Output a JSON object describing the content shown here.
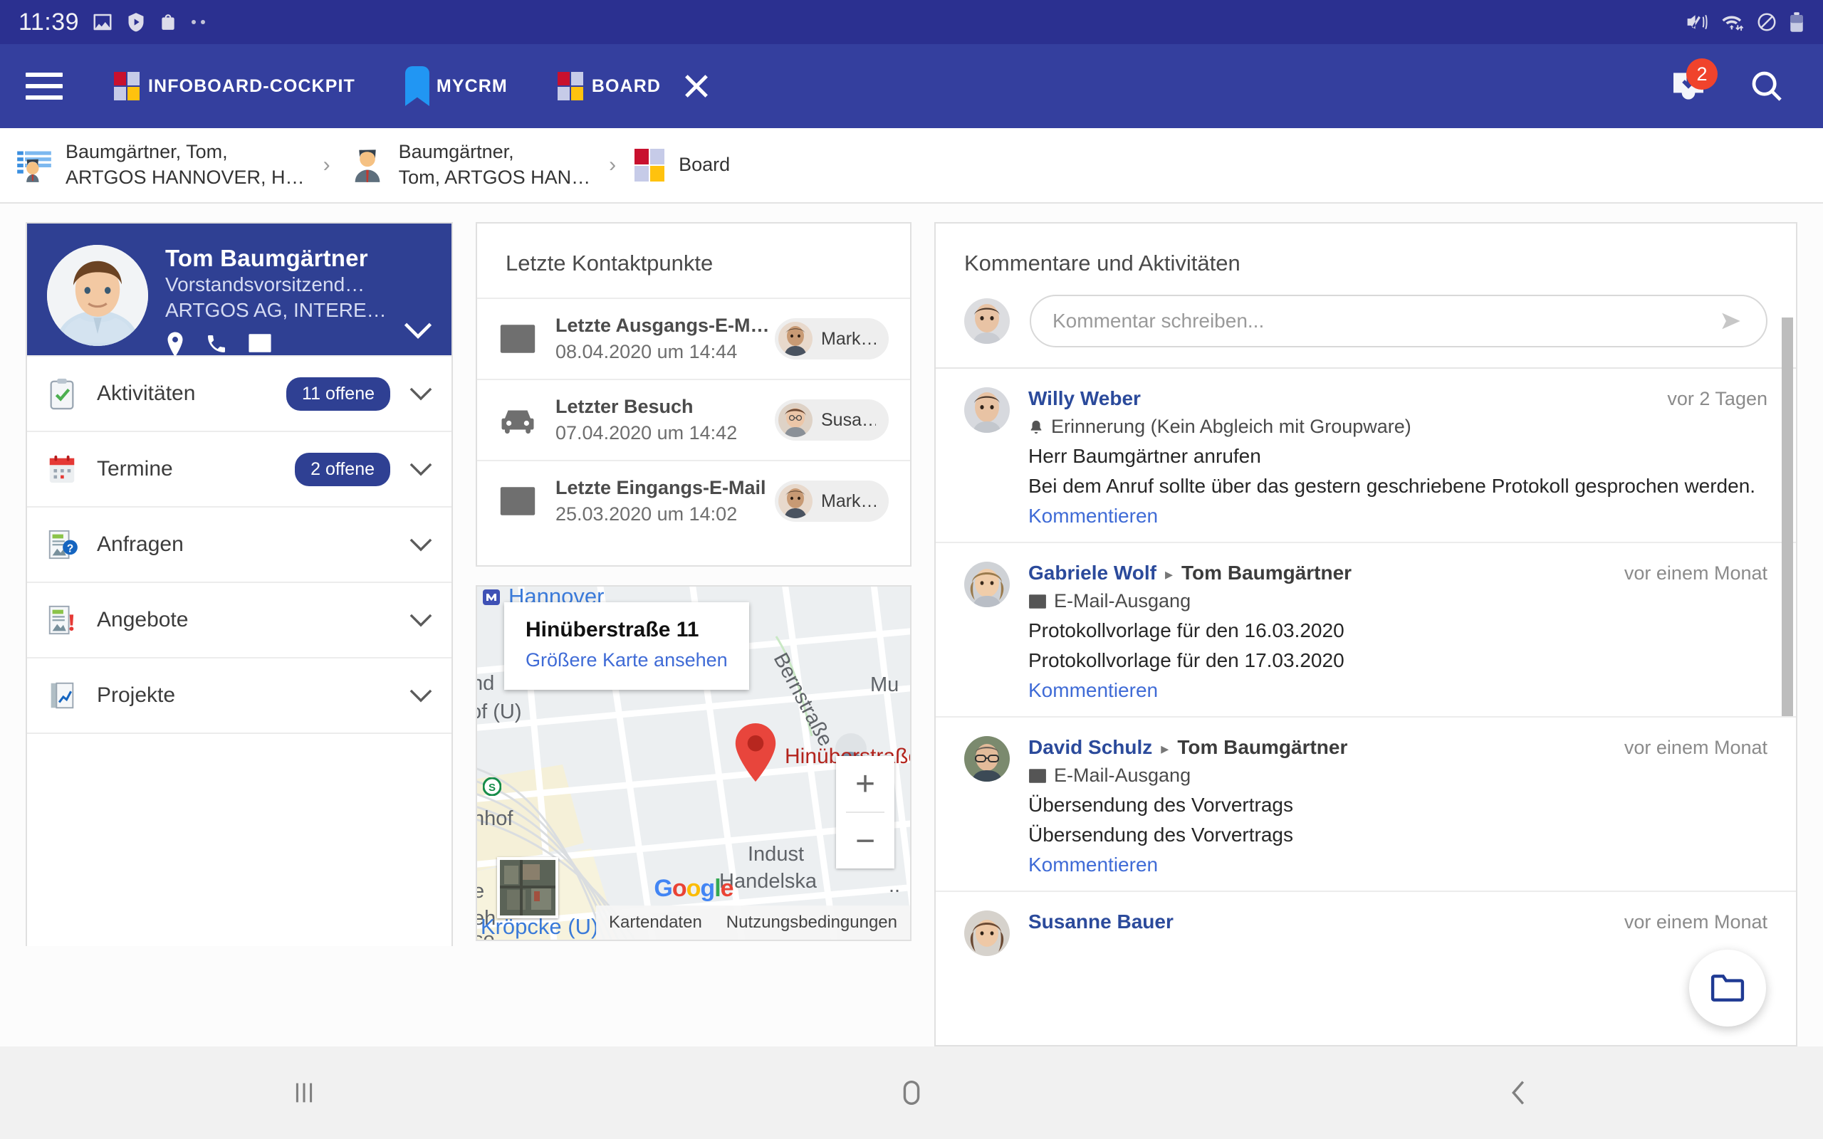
{
  "statusbar": {
    "clock": "11:39",
    "left_icons": [
      "image-icon",
      "shield-play-icon",
      "shopping-bag-icon",
      "more-dots-icon"
    ],
    "right_icons": [
      "mute-vibrate-icon",
      "wifi-transfer-icon",
      "do-not-disturb-icon",
      "battery-icon"
    ]
  },
  "appbar": {
    "menu": "menu-icon",
    "tabs": [
      {
        "label": "INFOBOARD-COCKPIT",
        "icon": "infoboard-logo-icon"
      },
      {
        "label": "MYCRM",
        "icon": "bookmark-icon"
      },
      {
        "label": "BOARD",
        "icon": "infoboard-logo-icon",
        "closable": true
      }
    ],
    "inbox_icon": "inbox-download-icon",
    "inbox_badge": "2",
    "search_icon": "search-icon",
    "accent": "#343f9e",
    "badge_color": "#f0432c"
  },
  "breadcrumb": {
    "items": [
      {
        "label": "Baumgärtner, Tom,\nARTGOS HANNOVER, H…",
        "icon": "contact-list-icon"
      },
      {
        "label": "Baumgärtner,\nTom, ARTGOS HAN…",
        "icon": "person-icon"
      },
      {
        "label": "Board",
        "icon": "infoboard-logo-icon"
      }
    ],
    "separator": "›"
  },
  "profile": {
    "name": "Tom Baumgärtner",
    "role": "Vorstandsvorsitzend…",
    "company": "ARTGOS AG, INTERE…",
    "actions": [
      "location-pin-icon",
      "phone-icon",
      "mail-icon"
    ],
    "expand_icon": "chevron-down-icon",
    "header_color": "#2f4093",
    "rows": [
      {
        "label": "Aktivitäten",
        "badge": "11 offene",
        "icon": "clipboard-check-icon"
      },
      {
        "label": "Termine",
        "badge": "2 offene",
        "icon": "calendar-icon"
      },
      {
        "label": "Anfragen",
        "badge": "",
        "icon": "request-document-icon"
      },
      {
        "label": "Angebote",
        "badge": "",
        "icon": "offer-document-icon"
      },
      {
        "label": "Projekte",
        "badge": "",
        "icon": "project-chart-icon"
      }
    ]
  },
  "contact_points": {
    "title": "Letzte Kontaktpunkte",
    "items": [
      {
        "title": "Letzte Ausgangs-E-M…",
        "date": "08.04.2020 um 14:44",
        "person": "Mark…",
        "icon": "mail-icon"
      },
      {
        "title": "Letzter Besuch",
        "date": "07.04.2020 um 14:42",
        "person": "Susa…",
        "icon": "car-icon"
      },
      {
        "title": "Letzte Eingangs-E-Mail",
        "date": "25.03.2020 um 14:02",
        "person": "Mark…",
        "icon": "mail-icon"
      }
    ]
  },
  "map": {
    "info_title": "Hinüberstraße 11",
    "info_link": "Größere Karte ansehen",
    "pin_label": "Hinüberstraße 11",
    "city_label": "Hannover",
    "street_labels": [
      "Bernstraße",
      "Mu",
      "Indust",
      "Handelska",
      "nhof",
      "r Kröpcke (U)",
      "of (U)",
      "nd",
      "e",
      "eh",
      "se",
      "ne"
    ],
    "zoom_in": "+",
    "zoom_out": "−",
    "brand": "Google",
    "footer": [
      "Kartendaten",
      "Nutzungsbedingungen"
    ],
    "tiles_toggle": "satellite-thumbnail-icon"
  },
  "comments": {
    "title": "Kommentare und Aktivitäten",
    "input_placeholder": "Kommentar schreiben...",
    "send_icon": "send-icon",
    "comment_link": "Kommentieren",
    "entries": [
      {
        "author": "Willy Weber",
        "target": "",
        "time": "vor 2 Tagen",
        "type": "Erinnerung (Kein Abgleich mit Groupware)",
        "type_icon": "bell-icon",
        "lines": [
          "Herr Baumgärtner anrufen",
          "Bei dem Anruf sollte über das gestern geschriebene Protokoll gesprochen werden."
        ],
        "link": "Kommentieren",
        "avatar": "avatar-willy"
      },
      {
        "author": "Gabriele Wolf",
        "target": "Tom Baumgärtner",
        "time": "vor einem Monat",
        "type": "E-Mail-Ausgang",
        "type_icon": "mail-icon",
        "lines": [
          "Protokollvorlage für den 16.03.2020",
          "Protokollvorlage für den 17.03.2020"
        ],
        "link": "Kommentieren",
        "avatar": "avatar-gabriele"
      },
      {
        "author": "David Schulz",
        "target": "Tom Baumgärtner",
        "time": "vor einem Monat",
        "type": "E-Mail-Ausgang",
        "type_icon": "mail-icon",
        "lines": [
          "Übersendung des Vorvertrags",
          "Übersendung des Vorvertrags"
        ],
        "link": "Kommentieren",
        "avatar": "avatar-david"
      },
      {
        "author": "Susanne Bauer",
        "target": "",
        "time": "vor einem Monat",
        "type": "",
        "type_icon": "",
        "lines": [],
        "link": "",
        "avatar": "avatar-susanne"
      }
    ]
  },
  "fab": {
    "icon": "folder-icon"
  },
  "navbar": {
    "recents": "recents-icon",
    "home": "home-icon",
    "back": "back-icon"
  }
}
